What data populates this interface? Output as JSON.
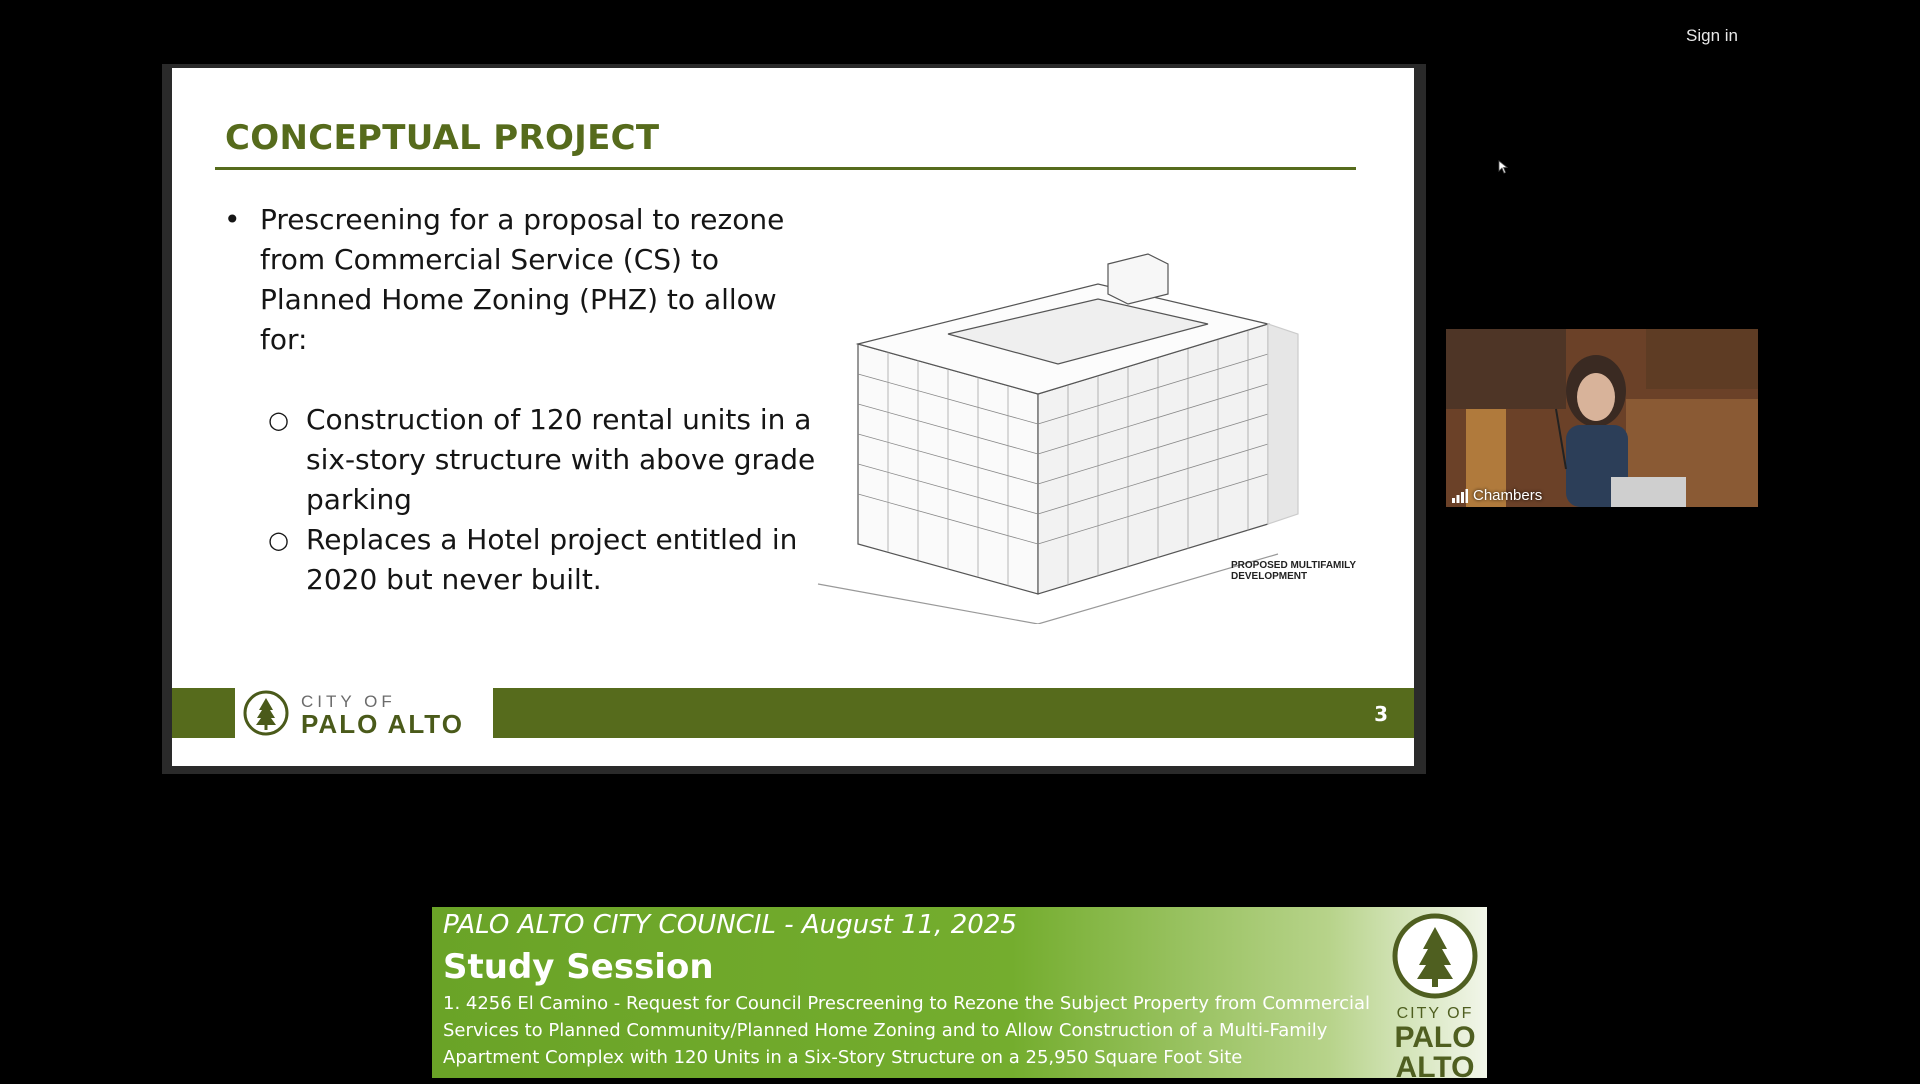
{
  "header": {
    "sign_in": "Sign in"
  },
  "slide": {
    "title": "CONCEPTUAL PROJECT",
    "bullet_main": "Prescreening for a proposal to rezone from Commercial Service (CS) to Planned Home Zoning (PHZ) to allow for:",
    "sub_bullets": [
      "Construction of 120 rental units in a six-story structure with above grade parking",
      "Replaces a Hotel project entitled in 2020 but never built."
    ],
    "image_caption_line1": "PROPOSED MULTIFAMILY",
    "image_caption_line2": "DEVELOPMENT",
    "logo_city": "CITY OF",
    "logo_name": "PALO ALTO",
    "page_number": "3",
    "accent_color": "#566b1c"
  },
  "video": {
    "label": "Chambers"
  },
  "banner": {
    "line1": "PALO ALTO CITY COUNCIL -  August 11, 2025",
    "line2": "Study Session",
    "description": "1. 4256 El Camino - Request for Council Prescreening to Rezone the Subject Property from Commercial Services to Planned Community/Planned Home Zoning  and to Allow Construction of a Multi-Family Apartment Complex with 120 Units in a Six-Story Structure on a 25,950 Square Foot Site",
    "logo_city": "CITY OF",
    "logo_name_1": "PALO",
    "logo_name_2": "ALTO",
    "color": "#6aa327"
  }
}
